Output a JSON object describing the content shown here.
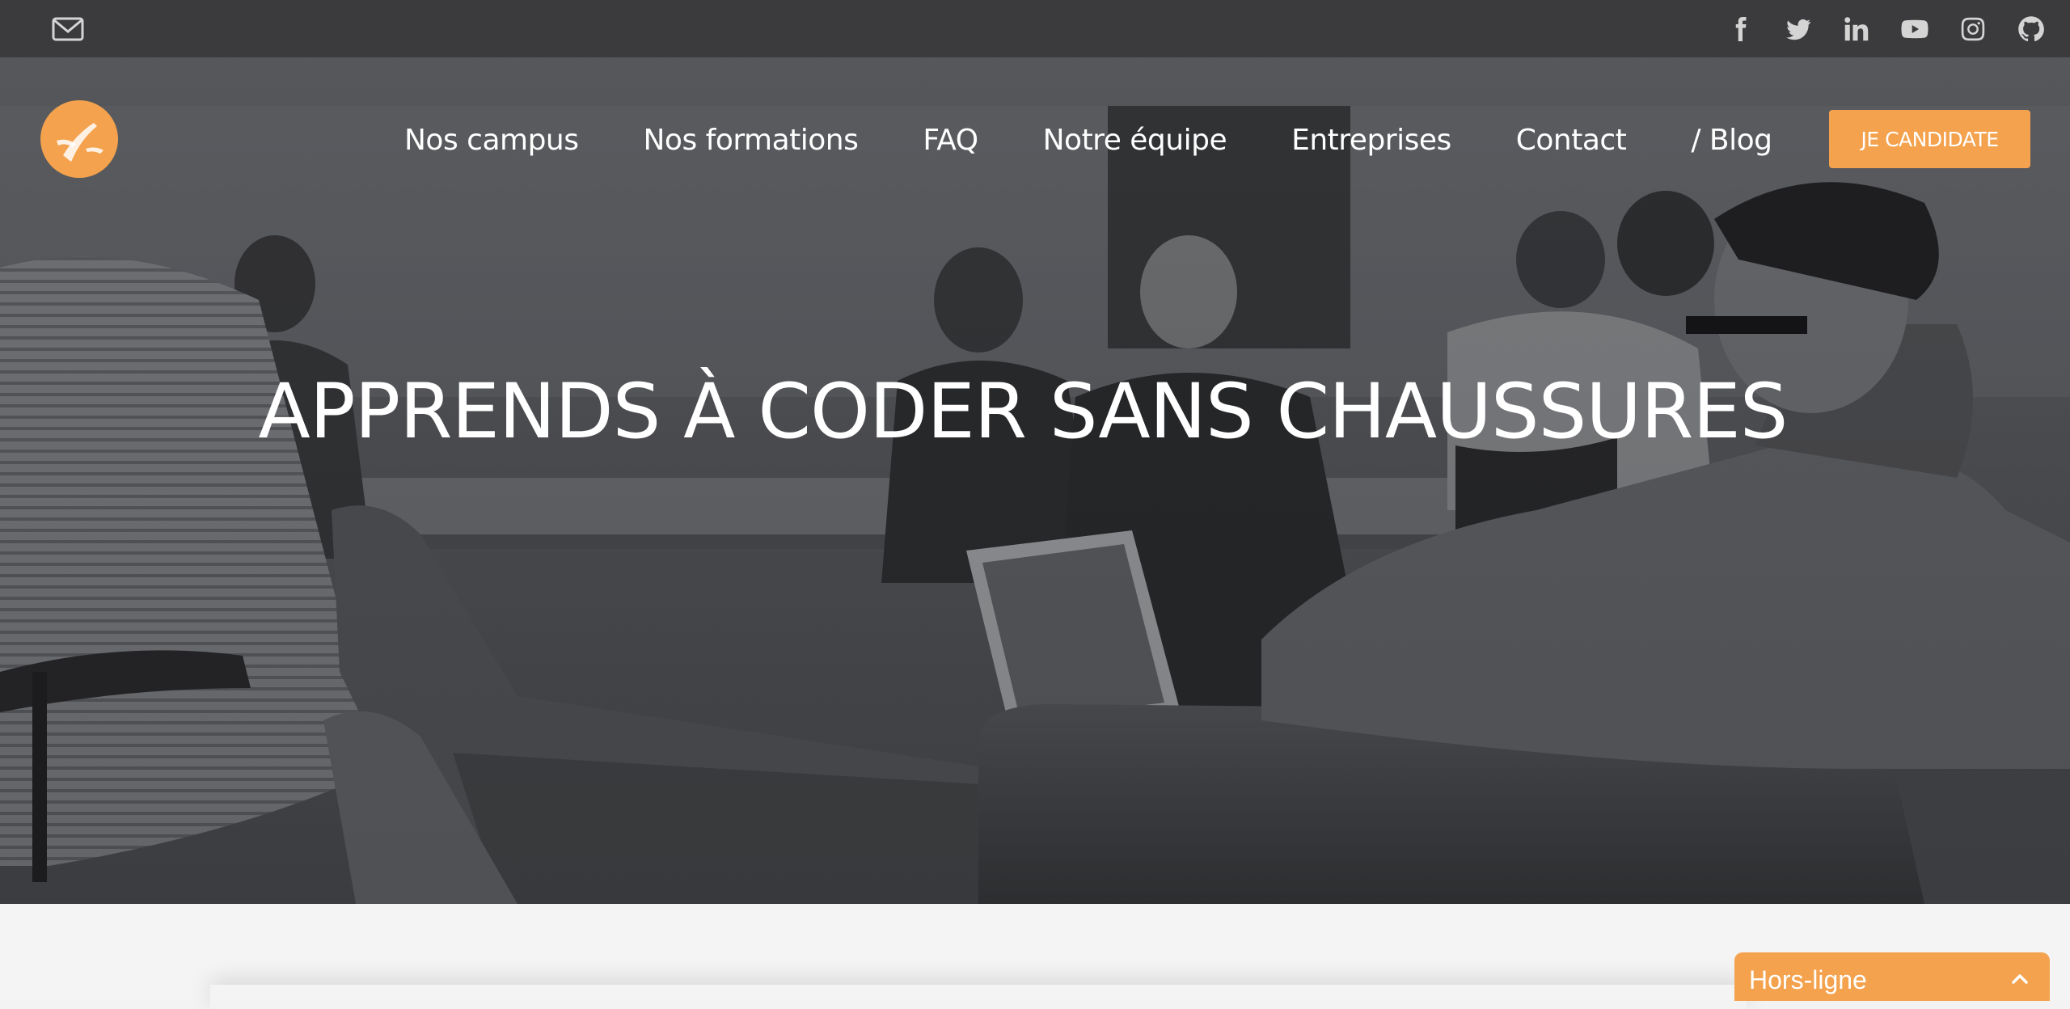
{
  "topbar": {
    "mail_icon": "envelope-icon",
    "social": [
      {
        "name": "facebook",
        "icon": "facebook-icon"
      },
      {
        "name": "twitter",
        "icon": "twitter-icon"
      },
      {
        "name": "linkedin",
        "icon": "linkedin-icon"
      },
      {
        "name": "youtube",
        "icon": "youtube-icon"
      },
      {
        "name": "instagram",
        "icon": "instagram-icon"
      },
      {
        "name": "github",
        "icon": "github-icon"
      }
    ]
  },
  "header": {
    "logo_icon": "logo-icon",
    "nav": [
      "Nos campus",
      "Nos formations",
      "FAQ",
      "Notre équipe",
      "Entreprises",
      "Contact",
      "/ Blog"
    ],
    "cta_label": "JE CANDIDATE"
  },
  "hero": {
    "headline": "APPRENDS À CODER SANS CHAUSSURES"
  },
  "chat": {
    "label": "Hors-ligne",
    "icon": "chevron-up-icon"
  },
  "colors": {
    "accent": "#f4a24d",
    "topbar": "#3b3b3d",
    "page_bg": "#f4f4f4"
  }
}
